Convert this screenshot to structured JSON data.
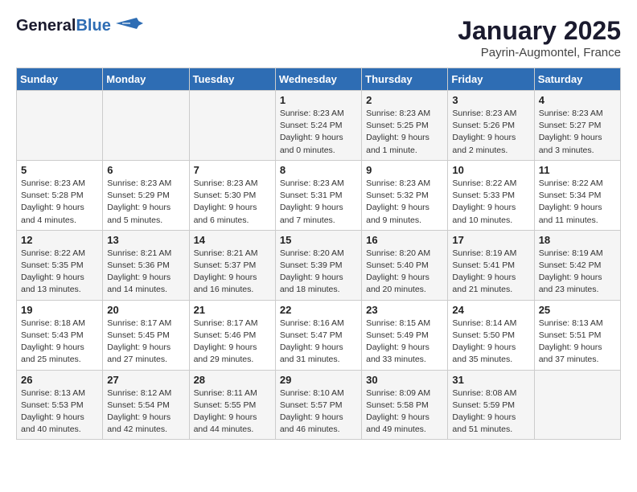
{
  "header": {
    "logo_line1": "General",
    "logo_line2": "Blue",
    "title": "January 2025",
    "subtitle": "Payrin-Augmontel, France"
  },
  "columns": [
    "Sunday",
    "Monday",
    "Tuesday",
    "Wednesday",
    "Thursday",
    "Friday",
    "Saturday"
  ],
  "weeks": [
    [
      {
        "day": "",
        "info": ""
      },
      {
        "day": "",
        "info": ""
      },
      {
        "day": "",
        "info": ""
      },
      {
        "day": "1",
        "info": "Sunrise: 8:23 AM\nSunset: 5:24 PM\nDaylight: 9 hours\nand 0 minutes."
      },
      {
        "day": "2",
        "info": "Sunrise: 8:23 AM\nSunset: 5:25 PM\nDaylight: 9 hours\nand 1 minute."
      },
      {
        "day": "3",
        "info": "Sunrise: 8:23 AM\nSunset: 5:26 PM\nDaylight: 9 hours\nand 2 minutes."
      },
      {
        "day": "4",
        "info": "Sunrise: 8:23 AM\nSunset: 5:27 PM\nDaylight: 9 hours\nand 3 minutes."
      }
    ],
    [
      {
        "day": "5",
        "info": "Sunrise: 8:23 AM\nSunset: 5:28 PM\nDaylight: 9 hours\nand 4 minutes."
      },
      {
        "day": "6",
        "info": "Sunrise: 8:23 AM\nSunset: 5:29 PM\nDaylight: 9 hours\nand 5 minutes."
      },
      {
        "day": "7",
        "info": "Sunrise: 8:23 AM\nSunset: 5:30 PM\nDaylight: 9 hours\nand 6 minutes."
      },
      {
        "day": "8",
        "info": "Sunrise: 8:23 AM\nSunset: 5:31 PM\nDaylight: 9 hours\nand 7 minutes."
      },
      {
        "day": "9",
        "info": "Sunrise: 8:23 AM\nSunset: 5:32 PM\nDaylight: 9 hours\nand 9 minutes."
      },
      {
        "day": "10",
        "info": "Sunrise: 8:22 AM\nSunset: 5:33 PM\nDaylight: 9 hours\nand 10 minutes."
      },
      {
        "day": "11",
        "info": "Sunrise: 8:22 AM\nSunset: 5:34 PM\nDaylight: 9 hours\nand 11 minutes."
      }
    ],
    [
      {
        "day": "12",
        "info": "Sunrise: 8:22 AM\nSunset: 5:35 PM\nDaylight: 9 hours\nand 13 minutes."
      },
      {
        "day": "13",
        "info": "Sunrise: 8:21 AM\nSunset: 5:36 PM\nDaylight: 9 hours\nand 14 minutes."
      },
      {
        "day": "14",
        "info": "Sunrise: 8:21 AM\nSunset: 5:37 PM\nDaylight: 9 hours\nand 16 minutes."
      },
      {
        "day": "15",
        "info": "Sunrise: 8:20 AM\nSunset: 5:39 PM\nDaylight: 9 hours\nand 18 minutes."
      },
      {
        "day": "16",
        "info": "Sunrise: 8:20 AM\nSunset: 5:40 PM\nDaylight: 9 hours\nand 20 minutes."
      },
      {
        "day": "17",
        "info": "Sunrise: 8:19 AM\nSunset: 5:41 PM\nDaylight: 9 hours\nand 21 minutes."
      },
      {
        "day": "18",
        "info": "Sunrise: 8:19 AM\nSunset: 5:42 PM\nDaylight: 9 hours\nand 23 minutes."
      }
    ],
    [
      {
        "day": "19",
        "info": "Sunrise: 8:18 AM\nSunset: 5:43 PM\nDaylight: 9 hours\nand 25 minutes."
      },
      {
        "day": "20",
        "info": "Sunrise: 8:17 AM\nSunset: 5:45 PM\nDaylight: 9 hours\nand 27 minutes."
      },
      {
        "day": "21",
        "info": "Sunrise: 8:17 AM\nSunset: 5:46 PM\nDaylight: 9 hours\nand 29 minutes."
      },
      {
        "day": "22",
        "info": "Sunrise: 8:16 AM\nSunset: 5:47 PM\nDaylight: 9 hours\nand 31 minutes."
      },
      {
        "day": "23",
        "info": "Sunrise: 8:15 AM\nSunset: 5:49 PM\nDaylight: 9 hours\nand 33 minutes."
      },
      {
        "day": "24",
        "info": "Sunrise: 8:14 AM\nSunset: 5:50 PM\nDaylight: 9 hours\nand 35 minutes."
      },
      {
        "day": "25",
        "info": "Sunrise: 8:13 AM\nSunset: 5:51 PM\nDaylight: 9 hours\nand 37 minutes."
      }
    ],
    [
      {
        "day": "26",
        "info": "Sunrise: 8:13 AM\nSunset: 5:53 PM\nDaylight: 9 hours\nand 40 minutes."
      },
      {
        "day": "27",
        "info": "Sunrise: 8:12 AM\nSunset: 5:54 PM\nDaylight: 9 hours\nand 42 minutes."
      },
      {
        "day": "28",
        "info": "Sunrise: 8:11 AM\nSunset: 5:55 PM\nDaylight: 9 hours\nand 44 minutes."
      },
      {
        "day": "29",
        "info": "Sunrise: 8:10 AM\nSunset: 5:57 PM\nDaylight: 9 hours\nand 46 minutes."
      },
      {
        "day": "30",
        "info": "Sunrise: 8:09 AM\nSunset: 5:58 PM\nDaylight: 9 hours\nand 49 minutes."
      },
      {
        "day": "31",
        "info": "Sunrise: 8:08 AM\nSunset: 5:59 PM\nDaylight: 9 hours\nand 51 minutes."
      },
      {
        "day": "",
        "info": ""
      }
    ]
  ]
}
